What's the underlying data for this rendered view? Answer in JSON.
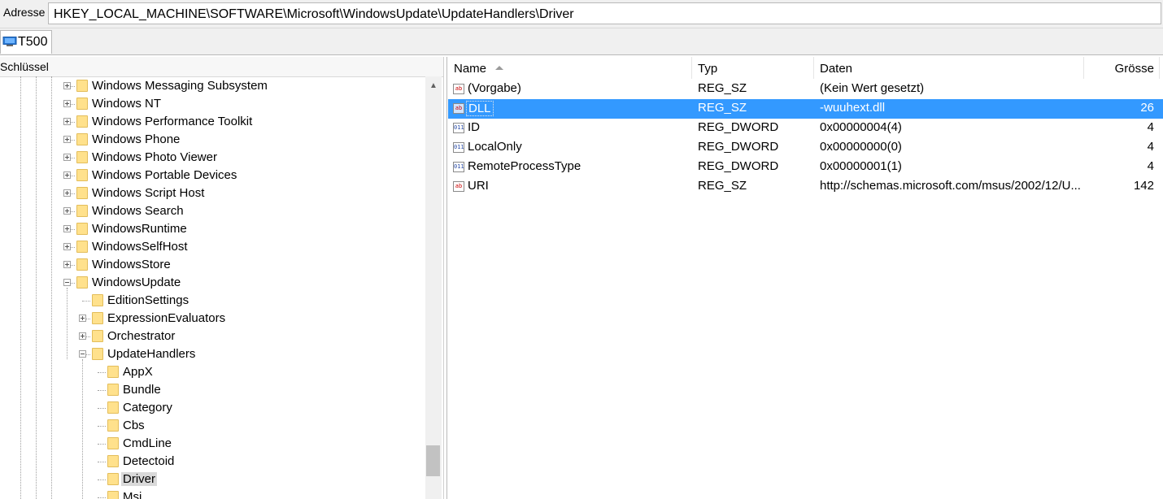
{
  "address": {
    "label": "Adresse",
    "path": "HKEY_LOCAL_MACHINE\\SOFTWARE\\Microsoft\\WindowsUpdate\\UpdateHandlers\\Driver"
  },
  "tab": {
    "label": "T500",
    "icon": "computer-icon"
  },
  "tree": {
    "header": "Schlüssel",
    "items": [
      {
        "label": "Windows Messaging Subsystem",
        "expander": "plus"
      },
      {
        "label": "Windows NT",
        "expander": "plus"
      },
      {
        "label": "Windows Performance Toolkit",
        "expander": "plus"
      },
      {
        "label": "Windows Phone",
        "expander": "plus"
      },
      {
        "label": "Windows Photo Viewer",
        "expander": "plus"
      },
      {
        "label": "Windows Portable Devices",
        "expander": "plus"
      },
      {
        "label": "Windows Script Host",
        "expander": "plus"
      },
      {
        "label": "Windows Search",
        "expander": "plus"
      },
      {
        "label": "WindowsRuntime",
        "expander": "plus"
      },
      {
        "label": "WindowsSelfHost",
        "expander": "plus"
      },
      {
        "label": "WindowsStore",
        "expander": "plus"
      },
      {
        "label": "WindowsUpdate",
        "expander": "minus"
      },
      {
        "label": "EditionSettings",
        "expander": "none"
      },
      {
        "label": "ExpressionEvaluators",
        "expander": "plus"
      },
      {
        "label": "Orchestrator",
        "expander": "plus"
      },
      {
        "label": "UpdateHandlers",
        "expander": "minus"
      },
      {
        "label": "AppX",
        "expander": "none"
      },
      {
        "label": "Bundle",
        "expander": "none"
      },
      {
        "label": "Category",
        "expander": "none"
      },
      {
        "label": "Cbs",
        "expander": "none"
      },
      {
        "label": "CmdLine",
        "expander": "none"
      },
      {
        "label": "Detectoid",
        "expander": "none"
      },
      {
        "label": "Driver",
        "expander": "none",
        "selected": true
      },
      {
        "label": "Msi",
        "expander": "none"
      }
    ]
  },
  "list": {
    "columns": {
      "name": "Name",
      "type": "Typ",
      "data": "Daten",
      "size": "Grösse"
    },
    "rows": [
      {
        "name": "(Vorgabe)",
        "type": "REG_SZ",
        "data": "(Kein Wert gesetzt)",
        "size": "",
        "icon": "string-value-icon"
      },
      {
        "name": "DLL",
        "type": "REG_SZ",
        "data": "-wuuhext.dll",
        "size": "26",
        "icon": "string-value-icon",
        "selected": true
      },
      {
        "name": "ID",
        "type": "REG_DWORD",
        "data": "0x00000004(4)",
        "size": "4",
        "icon": "binary-value-icon"
      },
      {
        "name": "LocalOnly",
        "type": "REG_DWORD",
        "data": "0x00000000(0)",
        "size": "4",
        "icon": "binary-value-icon"
      },
      {
        "name": "RemoteProcessType",
        "type": "REG_DWORD",
        "data": "0x00000001(1)",
        "size": "4",
        "icon": "binary-value-icon"
      },
      {
        "name": "URI",
        "type": "REG_SZ",
        "data": "http://schemas.microsoft.com/msus/2002/12/U...",
        "size": "142",
        "icon": "string-value-icon"
      }
    ]
  },
  "colors": {
    "selection": "#3399ff",
    "folder": "#ffe18c"
  }
}
